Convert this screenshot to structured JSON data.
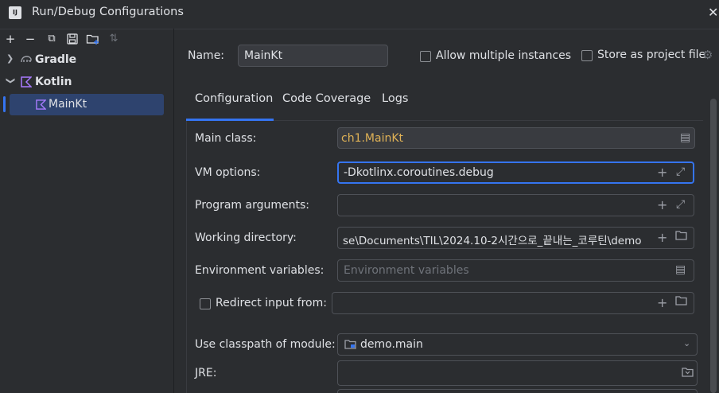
{
  "window": {
    "title": "Run/Debug Configurations",
    "app_icon_text": "IJ"
  },
  "toolbar": {
    "add": "+",
    "remove": "−",
    "copy": "⧉",
    "save": "🖫",
    "new_folder": "🗀",
    "sort": "⇅"
  },
  "tree": {
    "items": [
      {
        "label": "Gradle",
        "expanded": false
      },
      {
        "label": "Kotlin",
        "expanded": true
      },
      {
        "label": "MainKt",
        "selected": true
      }
    ]
  },
  "header": {
    "name_label": "Name:",
    "name_value": "MainKt",
    "allow_multiple_label": "Allow multiple instances",
    "store_project_label": "Store as project file"
  },
  "tabs": [
    {
      "label": "Configuration",
      "active": true
    },
    {
      "label": "Code Coverage",
      "active": false
    },
    {
      "label": "Logs",
      "active": false
    }
  ],
  "form": {
    "main_class_label": "Main class:",
    "main_class_value": "ch1.MainKt",
    "vm_options_label": "VM options:",
    "vm_options_value": "-Dkotlinx.coroutines.debug",
    "program_args_label": "Program arguments:",
    "program_args_value": "",
    "working_dir_label": "Working directory:",
    "working_dir_value": "se\\Documents\\TIL\\2024.10-2시간으로_끝내는_코루틴\\demo",
    "env_vars_label": "Environment variables:",
    "env_vars_placeholder": "Environment variables",
    "redirect_label": "Redirect input from:",
    "redirect_value": "",
    "classpath_label": "Use classpath of module:",
    "classpath_value": "demo.main",
    "jre_label": "JRE:",
    "jre_value": ""
  },
  "colors": {
    "accent": "#3574f0",
    "main_class_text": "#e0b256",
    "selection_bg": "#2e436e",
    "gradle_icon": "#9da0a8",
    "kotlin_icon": "#a97bff"
  }
}
